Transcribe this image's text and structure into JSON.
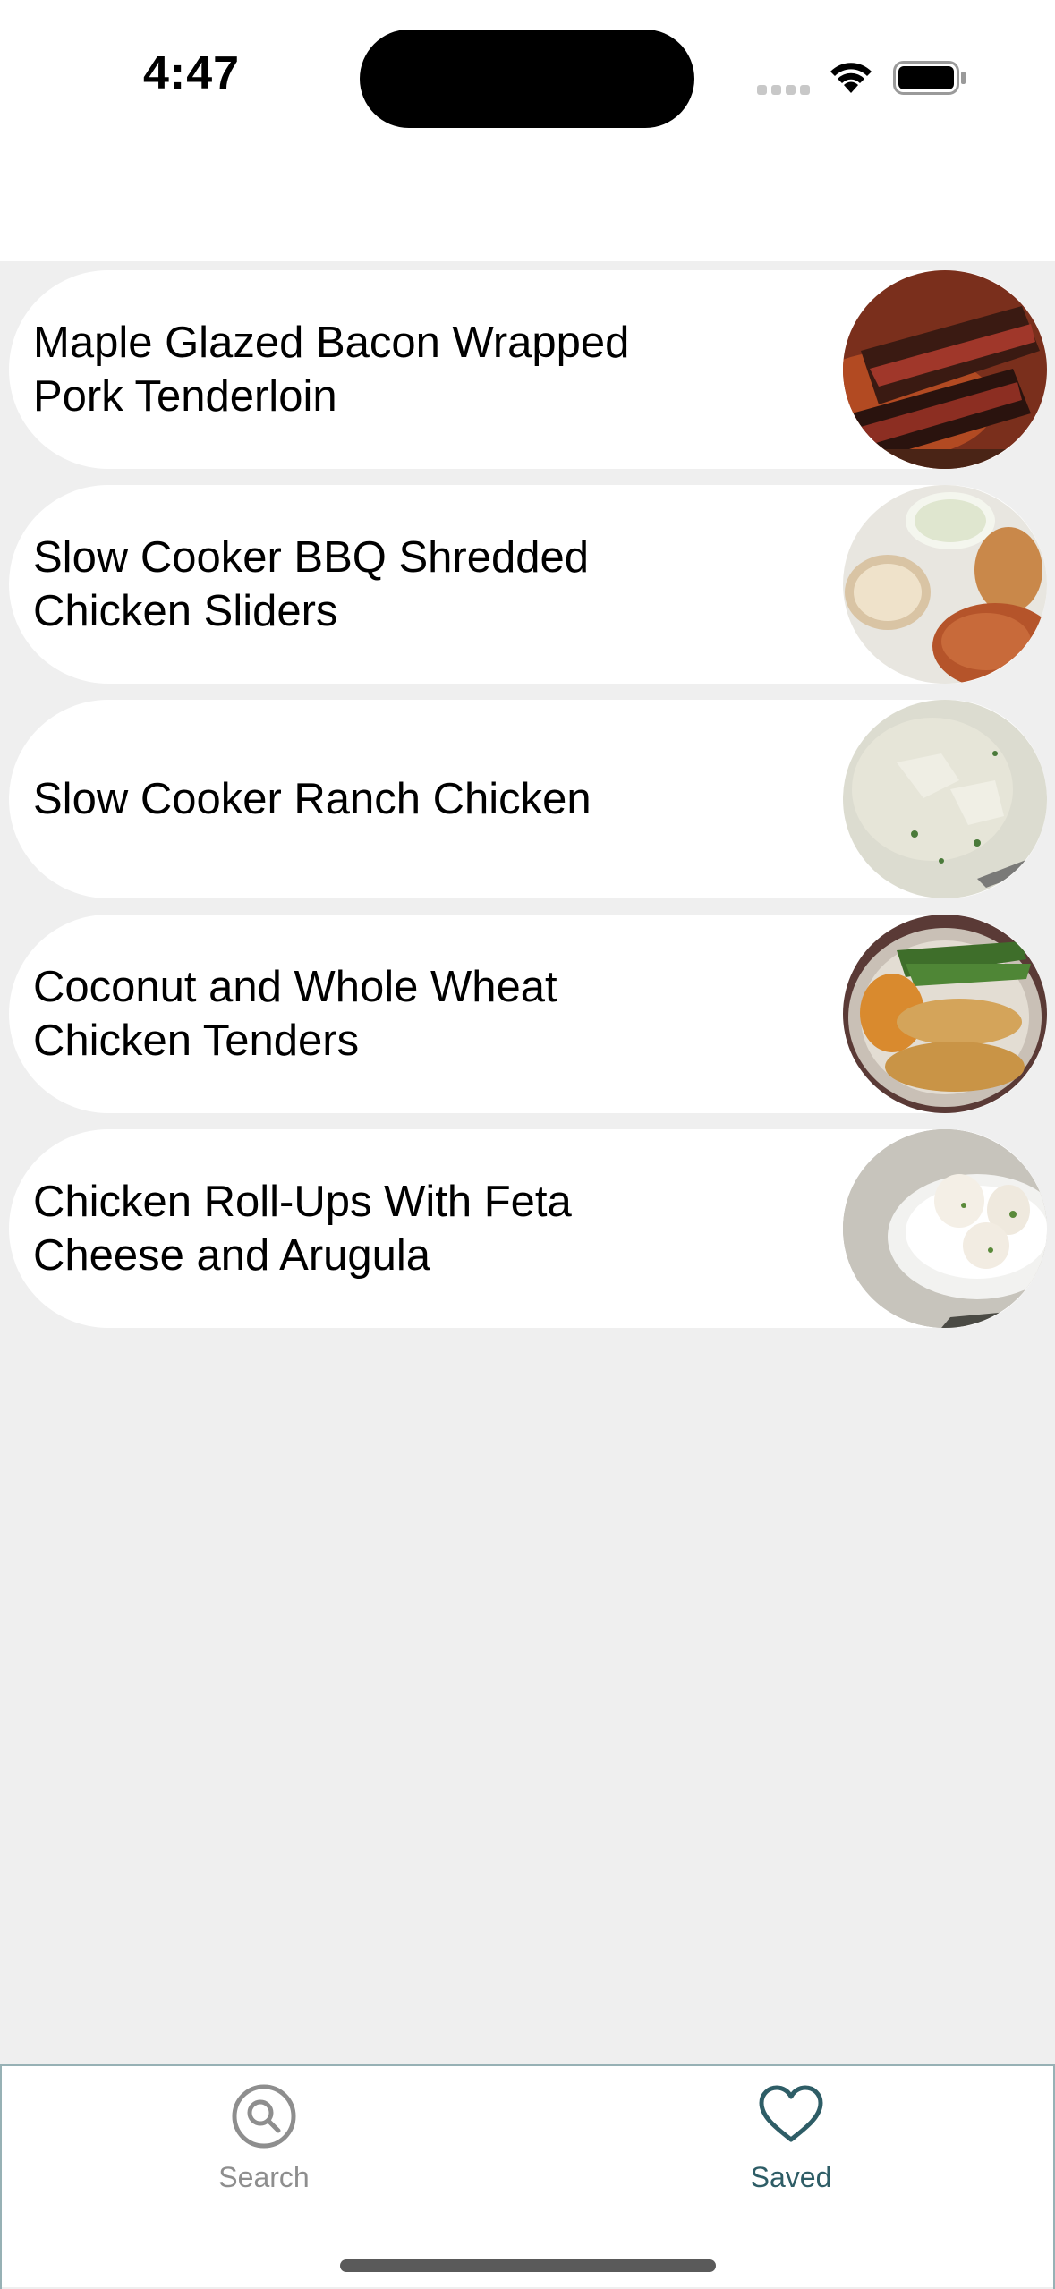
{
  "status_bar": {
    "time": "4:47"
  },
  "recipes": [
    {
      "title": "Maple Glazed Bacon Wrapped Pork Tenderloin"
    },
    {
      "title": "Slow Cooker BBQ Shredded Chicken Sliders"
    },
    {
      "title": "Slow Cooker Ranch Chicken"
    },
    {
      "title": "Coconut and Whole Wheat Chicken Tenders"
    },
    {
      "title": "Chicken Roll-Ups With Feta Cheese and Arugula"
    }
  ],
  "tabbar": {
    "search_label": "Search",
    "saved_label": "Saved",
    "active_tab": "Saved",
    "search_icon": "magnifier-icon",
    "saved_icon": "heart-icon"
  },
  "colors": {
    "background": "#efefef",
    "card": "#ffffff",
    "active_tab": "#2e5d66",
    "inactive_tab": "#8e8e8e",
    "tabbar_border": "#97b1b5"
  }
}
